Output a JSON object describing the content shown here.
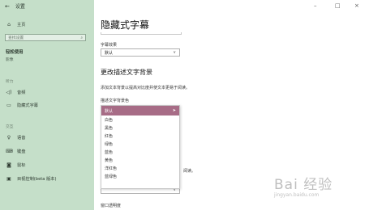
{
  "sidebar": {
    "back_label": "设置",
    "home": "主页",
    "search_placeholder": "查找设置",
    "section_title": "轻松使用",
    "section_sub": "影像",
    "groups": {
      "hearing": "听力",
      "interaction": "交互"
    },
    "items": [
      {
        "icon": "speaker-icon",
        "label": "音频"
      },
      {
        "icon": "captions-icon",
        "label": "隐藏式字幕"
      },
      {
        "icon": "mic-icon",
        "label": "语音"
      },
      {
        "icon": "keyboard-icon",
        "label": "键盘"
      },
      {
        "icon": "mouse-icon",
        "label": "鼠标"
      },
      {
        "icon": "eye-control-icon",
        "label": "目视控制(beta 版本)"
      }
    ]
  },
  "window": {
    "minimize": "–",
    "maximize": "□",
    "close": "×"
  },
  "main": {
    "title": "隐藏式字幕",
    "font_effect_label": "字幕效果",
    "font_effect_value": "默认",
    "section_title": "更改描述文字背景",
    "section_desc": "添加文本背景以提高对比度并使文本更易于阅读。",
    "bg_color_label": "描述文字背景色",
    "partial_desc": "阅读。",
    "window_transparency_label": "窗口透明度"
  },
  "dropdown": {
    "selected": "默认",
    "options": [
      "白色",
      "黑色",
      "红色",
      "绿色",
      "蓝色",
      "黄色",
      "洋红色",
      "蓝绿色"
    ]
  },
  "watermark": {
    "brand": "Bai 经验",
    "domain": "jingyan.baidu.com"
  },
  "colors": {
    "sidebar_bg": "#c5dfc9",
    "dropdown_selected": "#a76c86"
  }
}
